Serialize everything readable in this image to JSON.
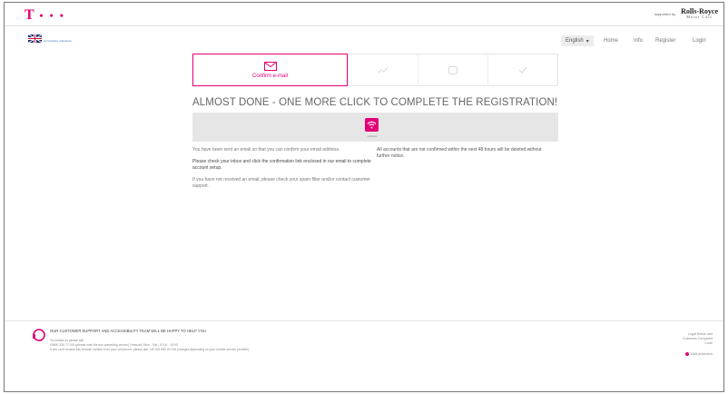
{
  "brand": {
    "logo_letter": "T",
    "logo_dots": "• • •",
    "sponsor_label": "supported by",
    "sponsor_name": "Rolls-Royce",
    "sponsor_sub": "Motor Cars"
  },
  "nav": {
    "accessibility_link": "Accessibility adaptation",
    "language": "English",
    "items": [
      "Home",
      "Info",
      "Register",
      "Login"
    ]
  },
  "steps": [
    {
      "label": "Confirm e-mail",
      "icon": "envelope-icon",
      "active": true
    },
    {
      "label": "",
      "icon": "chart-icon",
      "active": false
    },
    {
      "label": "",
      "icon": "device-icon",
      "active": false
    },
    {
      "label": "",
      "icon": "checkmark-icon",
      "active": false
    }
  ],
  "headline": "ALMOST DONE - ONE MORE CLICK TO COMPLETE THE REGISTRATION!",
  "band": {
    "caption": "HotSpot",
    "icon": "wifi-icon",
    "accent": "#e20074"
  },
  "content": {
    "left_p1": "You have been sent an email so that you can confirm your email address.",
    "left_p2": "Please check your inbox and click the confirmation link enclosed in our email to complete account setup.",
    "left_p3": "If you have not received an email, please check your spam filter and/or contact customer support.",
    "right_p1": "All accounts that are not confirmed within the next 48 hours will be deleted without further notice."
  },
  "footer": {
    "support_title": "OUR CUSTOMER SUPPORT AND ACCESSIBILITY TEAM WILL BE HAPPY TO HELP YOU",
    "support_line1": "To contact us please call:",
    "support_line2": "00800 330 77 000 (please note the two preceding zeroes) | freecall | Mon - Sat | 07:00 - 19:00",
    "support_line3": "If you can't access this freecall number from your cell phone, please dial +49 391 580 20 218 (charges depending on your mobile service provider)",
    "legal": "Legal Notice and Customer Complaint Code",
    "data_protection": "Data protection"
  },
  "colors": {
    "magenta": "#e20074",
    "band_gray": "#e6e6e6"
  }
}
